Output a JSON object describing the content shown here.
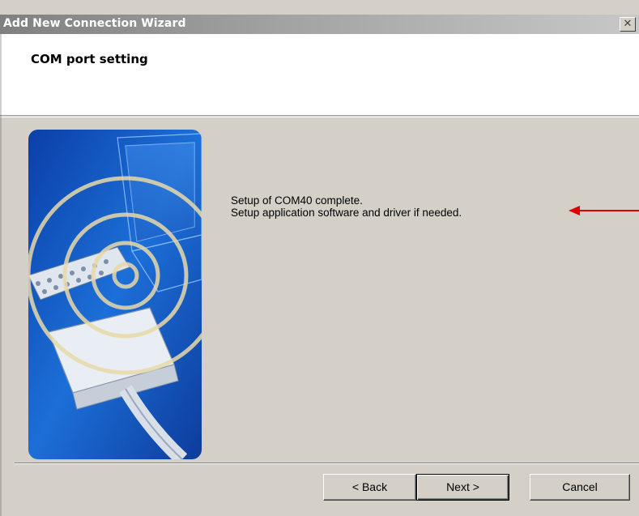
{
  "window": {
    "title": "Add New Connection Wizard",
    "close_label": "✕"
  },
  "header": {
    "heading": "COM port setting"
  },
  "message": {
    "line1": "Setup of COM40 complete.",
    "line2": "Setup application software and driver if needed."
  },
  "buttons": {
    "back": "< Back",
    "next": "Next >",
    "cancel": "Cancel"
  },
  "colors": {
    "annotation_arrow": "#e00000",
    "art_blue": "#1a5bc4"
  },
  "icons": {
    "close": "close-icon",
    "arrow": "annotation-arrow-icon"
  }
}
